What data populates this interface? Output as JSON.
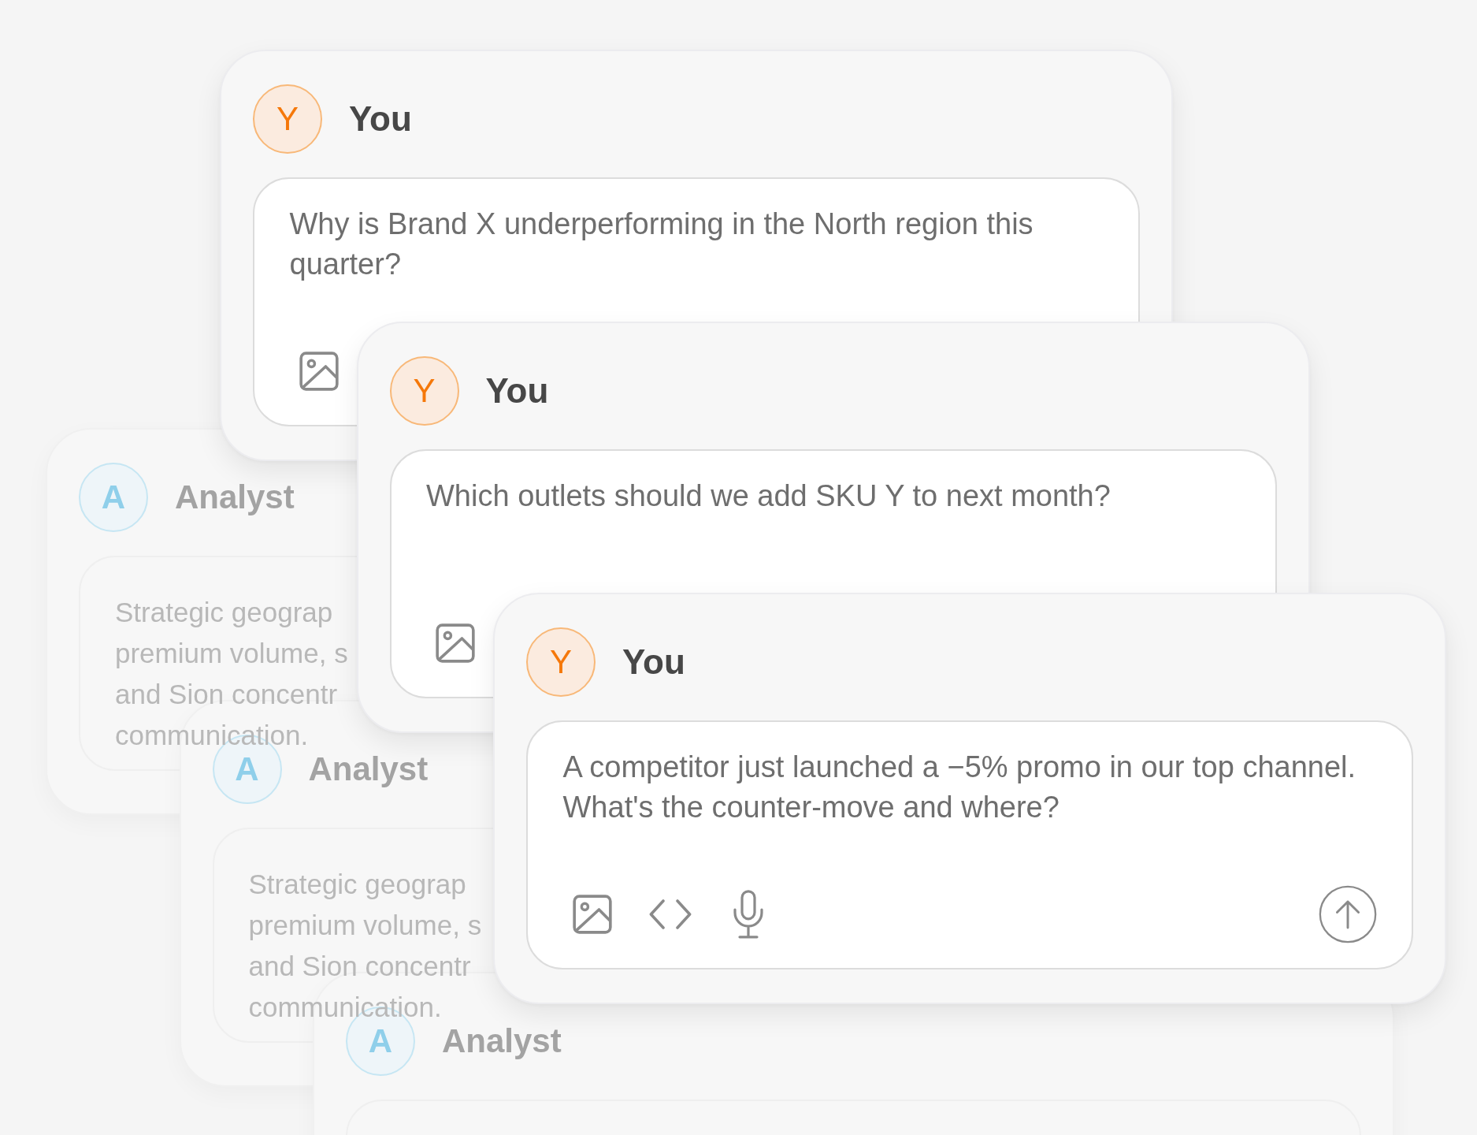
{
  "messages": [
    {
      "kind": "user",
      "avatar": "Y",
      "name": "You",
      "message": "Why is Brand X underperforming in the North region this quarter?",
      "tools": [
        {
          "kind": "image"
        }
      ]
    },
    {
      "kind": "analyst",
      "avatar": "A",
      "name": "Analyst",
      "text_lines": [
        "Strategic geograp",
        "premium volume, s",
        "and Sion concentr",
        "communication."
      ]
    },
    {
      "kind": "user",
      "avatar": "Y",
      "name": "You",
      "message": "Which outlets should we add SKU Y to next month?",
      "tools": [
        {
          "kind": "image"
        }
      ]
    },
    {
      "kind": "analyst",
      "avatar": "A",
      "name": "Analyst",
      "text_lines": [
        "Strategic geograp",
        "premium volume, s",
        "and Sion concentr",
        "communication."
      ]
    },
    {
      "kind": "user",
      "avatar": "Y",
      "name": "You",
      "message": "A competitor just launched a −5% promo in our top channel. What's the counter-move and where?",
      "tools": [
        {
          "kind": "image"
        },
        {
          "kind": "code"
        },
        {
          "kind": "mic"
        },
        {
          "kind": "send"
        }
      ]
    },
    {
      "kind": "analyst",
      "avatar": "A",
      "name": "Analyst"
    }
  ]
}
